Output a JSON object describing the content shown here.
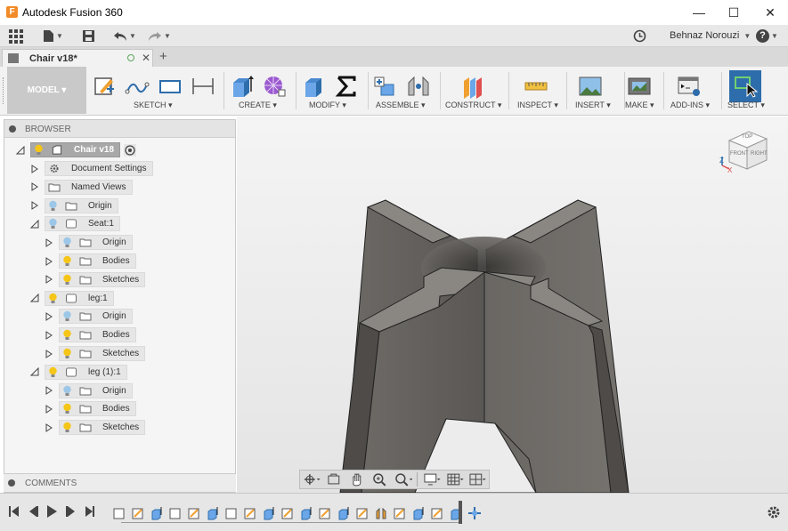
{
  "window": {
    "title": "Autodesk Fusion 360",
    "app_icon_letter": "F",
    "minimize": "—",
    "maximize": "☐",
    "close": "✕"
  },
  "quick_access": {
    "user_name": "Behnaz Norouzi",
    "help": "?"
  },
  "document_tab": {
    "name": "Chair v18*",
    "close": "✕",
    "add": "+"
  },
  "toolbar": {
    "workspace": "MODEL",
    "groups": [
      "SKETCH",
      "CREATE",
      "MODIFY",
      "ASSEMBLE",
      "CONSTRUCT",
      "INSPECT",
      "INSERT",
      "MAKE",
      "ADD-INS",
      "SELECT"
    ]
  },
  "browser": {
    "header": "BROWSER",
    "root": "Chair v18",
    "items": [
      {
        "label": "Document Settings"
      },
      {
        "label": "Named Views"
      },
      {
        "label": "Origin"
      },
      {
        "label": "Seat:1"
      },
      {
        "label": "Origin"
      },
      {
        "label": "Bodies"
      },
      {
        "label": "Sketches"
      },
      {
        "label": "leg:1"
      },
      {
        "label": "Origin"
      },
      {
        "label": "Bodies"
      },
      {
        "label": "Sketches"
      },
      {
        "label": "leg (1):1"
      },
      {
        "label": "Origin"
      },
      {
        "label": "Bodies"
      },
      {
        "label": "Sketches"
      }
    ]
  },
  "comments": {
    "header": "COMMENTS"
  },
  "viewcube": {
    "top": "TOP",
    "front": "FRONT",
    "right": "RIGHT",
    "axis_z": "Z",
    "axis_x": "X"
  },
  "colors": {
    "accent": "#2e6dab",
    "model_body": "#6b6863",
    "toolbar_bg": "#f2f2f2",
    "panel_bg": "#f5f5f5"
  }
}
